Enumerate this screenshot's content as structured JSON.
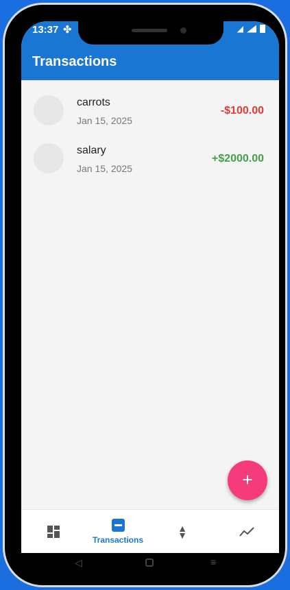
{
  "status_bar": {
    "time": "13:37"
  },
  "app_bar": {
    "title": "Transactions"
  },
  "transactions": [
    {
      "name": "carrots",
      "date": "Jan 15, 2025",
      "amount": "-$100.00",
      "sign": "negative"
    },
    {
      "name": "salary",
      "date": "Jan 15, 2025",
      "amount": "+$2000.00",
      "sign": "positive"
    }
  ],
  "fab": {
    "label": "+"
  },
  "bottom_nav": {
    "items": [
      {
        "id": "dashboard",
        "icon": "dashboard-icon",
        "label": ""
      },
      {
        "id": "transactions",
        "icon": "minus-box-icon",
        "label": "Transactions",
        "active": true
      },
      {
        "id": "sort",
        "icon": "sort-icon",
        "label": ""
      },
      {
        "id": "trends",
        "icon": "trending-icon",
        "label": ""
      }
    ]
  },
  "colors": {
    "primary": "#1976d2",
    "negative": "#e53935",
    "positive": "#43a047",
    "fab": "#f53b7b",
    "background": "#1b6ee0"
  }
}
